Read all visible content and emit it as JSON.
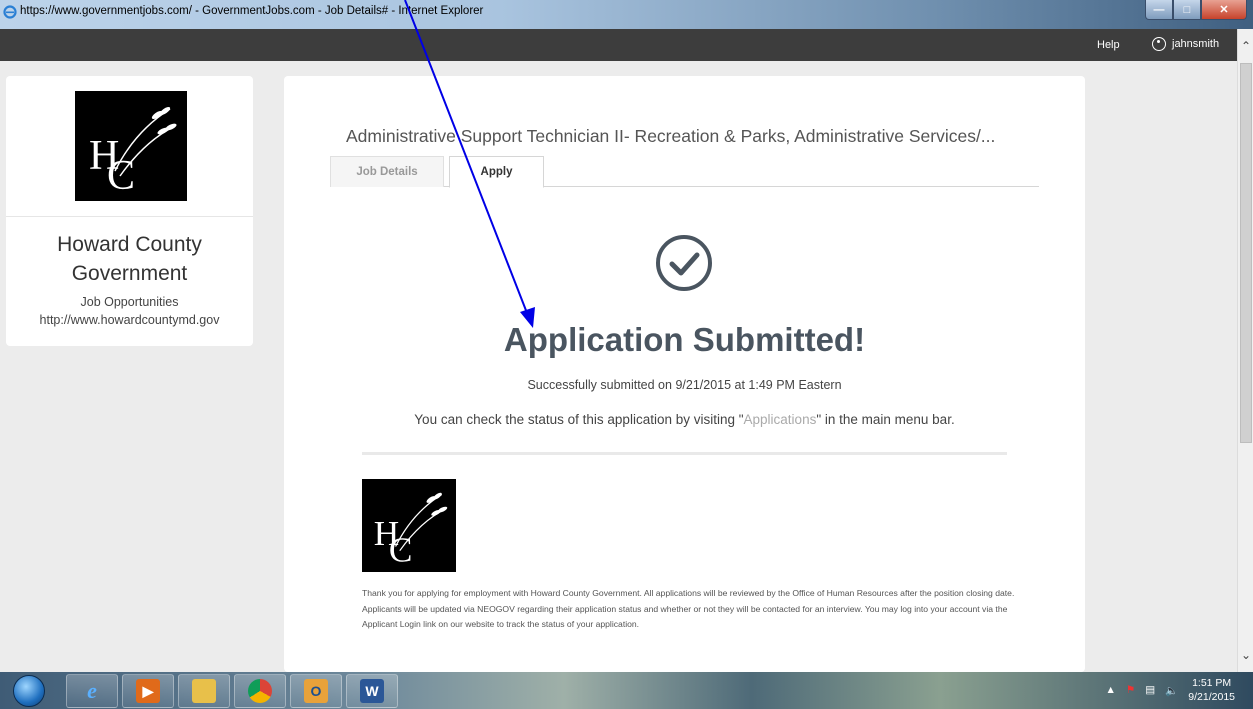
{
  "window": {
    "title": "https://www.governmentjobs.com/ - GovernmentJobs.com - Job Details# - Internet Explorer",
    "controls": [
      "minimize",
      "maximize",
      "close"
    ]
  },
  "topnav": {
    "help_label": "Help",
    "username": "jahnsmith"
  },
  "employer": {
    "name_line1": "Howard County",
    "name_line2": "Government",
    "subtitle": "Job Opportunities",
    "url": "http://www.howardcountymd.gov",
    "logo_letters": "HC"
  },
  "job": {
    "title": "Administrative Support Technician II- Recreation & Parks, Administrative Services/..."
  },
  "tabs": [
    {
      "label": "Job Details",
      "active": false
    },
    {
      "label": "Apply",
      "active": true
    }
  ],
  "confirmation": {
    "heading": "Application Submitted!",
    "submitted_text": "Successfully submitted on 9/21/2015 at 1:49 PM Eastern",
    "status_prefix": "You can check the status of this application by visiting \"",
    "status_link": "Applications",
    "status_suffix": "\" in the main menu bar.",
    "thank_you": "Thank you for applying for employment with Howard County Government. All applications will be reviewed by the Office of Human Resources after the position closing date. Applicants will be updated via NEOGOV regarding their application status and whether or not they will be contacted for an interview. You may log into your account via the Applicant Login link on our website to track the status of your application."
  },
  "taskbar": {
    "apps": [
      "internet-explorer",
      "media-player",
      "file-explorer",
      "chrome",
      "outlook",
      "word"
    ],
    "time": "1:51 PM",
    "date": "9/21/2015"
  },
  "colors": {
    "nav_bg": "#3d3d3d",
    "heading": "#4a5560",
    "arrow": "#0000e6"
  }
}
